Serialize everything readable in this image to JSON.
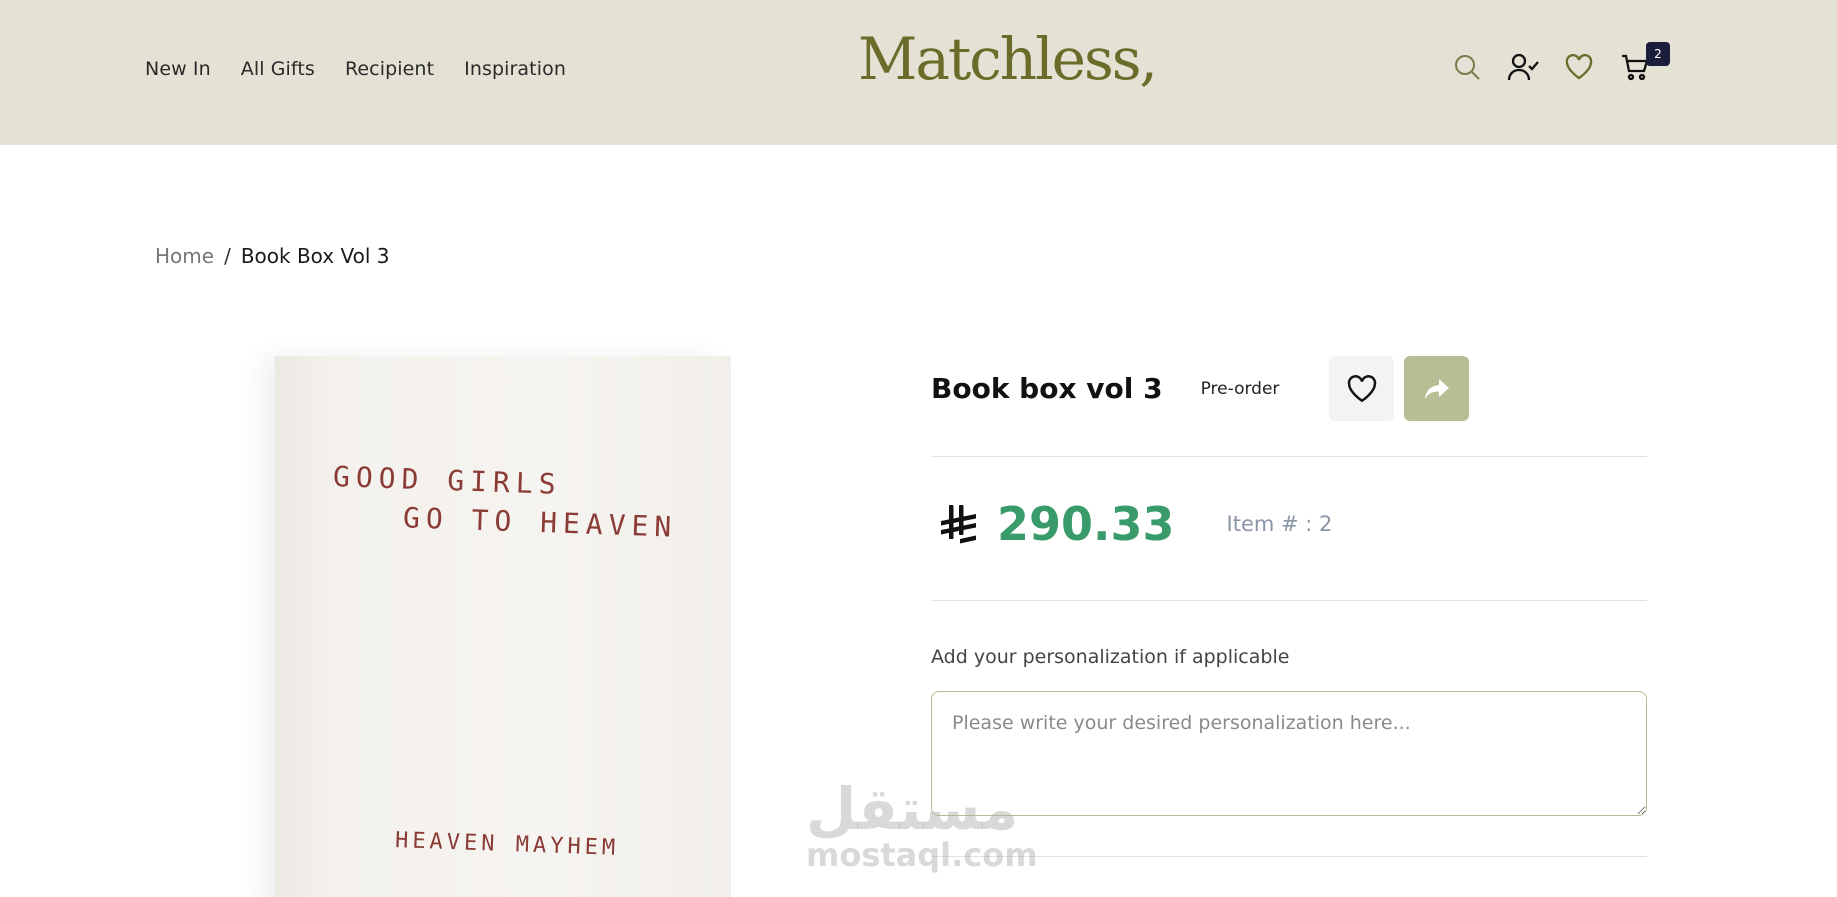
{
  "header": {
    "nav": [
      "New In",
      "All Gifts",
      "Recipient",
      "Inspiration"
    ],
    "logo": "Matchless,",
    "cart_count": "2",
    "icons": [
      "search-icon",
      "account-icon",
      "heart-icon",
      "cart-icon"
    ]
  },
  "breadcrumb": {
    "home": "Home",
    "separator": "/",
    "current": "Book Box Vol 3"
  },
  "product": {
    "title": "Book box vol 3",
    "status": "Pre-order",
    "price": "290.33",
    "currency_icon": "saudi-riyal-icon",
    "item_number": "Item # : 2",
    "image_text": {
      "line1": "GOOD GIRLS",
      "line2": "GO TO HEAVEN",
      "line3": "HEAVEN MAYHEM"
    }
  },
  "personalization": {
    "label": "Add your personalization if applicable",
    "placeholder": "Please write your desired personalization here..."
  },
  "watermark": {
    "arabic": "مستقل",
    "latin": "mostaql.com"
  },
  "colors": {
    "header_bg": "#e4e1d5",
    "brand": "#6b6b2a",
    "price": "#3a9b6a",
    "share_bg": "#b7bd94",
    "badge": "#1b1e3a"
  }
}
